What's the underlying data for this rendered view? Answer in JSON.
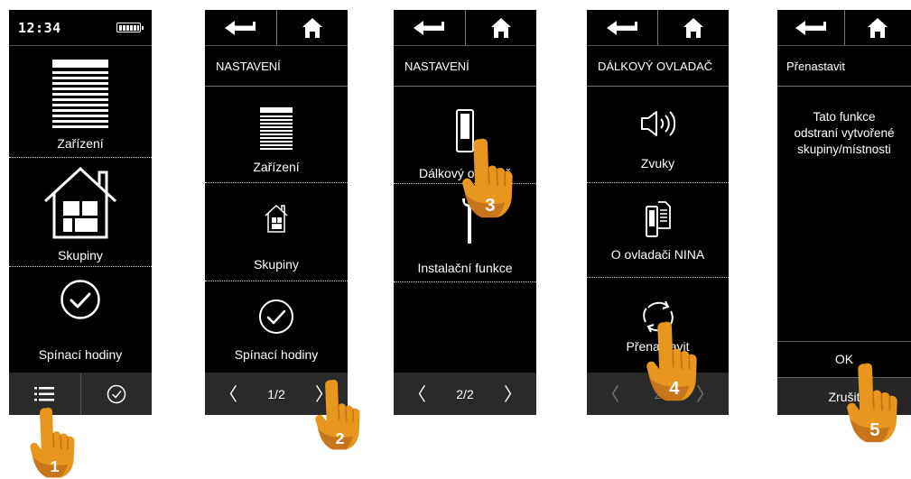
{
  "colors": {
    "screen_bg": "#000000",
    "text": "#ffffff",
    "bar_bg": "#2a2a2a",
    "hand_orange": "#e8961e",
    "hand_shade": "#c7741a"
  },
  "screen1": {
    "status": {
      "time": "12:34",
      "battery_icon": "battery-full-icon"
    },
    "items": [
      {
        "label": "Zařízení",
        "icon": "blinds-icon"
      },
      {
        "label": "Skupiny",
        "icon": "house-icon"
      },
      {
        "label": "Spínací hodiny",
        "icon": "checkmark-circle-icon"
      }
    ],
    "tabs": [
      {
        "icon": "menu-list-icon"
      },
      {
        "icon": "clock-check-icon"
      }
    ]
  },
  "screen2": {
    "title": "NASTAVENÍ",
    "items": [
      {
        "label": "Zařízení",
        "icon": "blinds-icon"
      },
      {
        "label": "Skupiny",
        "icon": "house-icon"
      },
      {
        "label": "Spínací hodiny",
        "icon": "checkmark-circle-icon"
      }
    ],
    "page": "1/2"
  },
  "screen3": {
    "title": "NASTAVENÍ",
    "items": [
      {
        "label": "Dálkový ovladač",
        "icon": "remote-control-icon"
      },
      {
        "label": "Instalační funkce",
        "icon": "wrench-screwdriver-icon"
      }
    ],
    "page": "2/2"
  },
  "screen4": {
    "title": "DÁLKOVÝ OVLADAČ",
    "items": [
      {
        "label": "Zvuky",
        "icon": "speaker-icon"
      },
      {
        "label": "O ovladači NINA",
        "icon": "remote-info-icon"
      },
      {
        "label": "Přenastavit",
        "icon": "refresh-icon"
      }
    ],
    "page": "2"
  },
  "screen5": {
    "title": "Přenastavit",
    "message": "Tato funkce\nodstraní vytvořené\nskupiny/místnosti",
    "ok": "OK",
    "cancel": "Zrušit"
  },
  "steps": [
    "1",
    "2",
    "3",
    "4",
    "5"
  ]
}
